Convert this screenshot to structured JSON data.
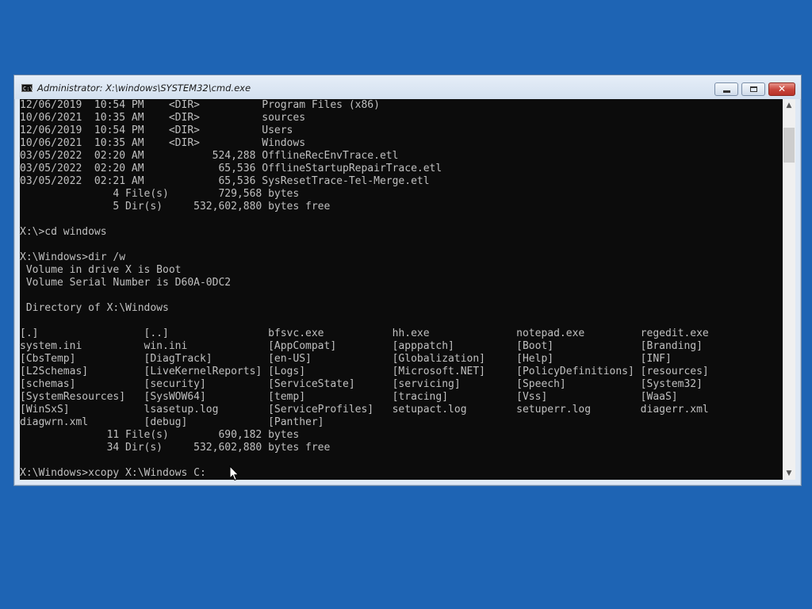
{
  "window": {
    "title": "Administrator: X:\\windows\\SYSTEM32\\cmd.exe",
    "app_icon_text": "C:\\"
  },
  "titlebar_controls": {
    "minimize": "minimize-icon",
    "maximize": "maximize-icon",
    "close": "close-icon"
  },
  "console": {
    "lines": [
      "12/06/2019  10:54 PM    <DIR>          Program Files (x86)",
      "10/06/2021  10:35 AM    <DIR>          sources",
      "12/06/2019  10:54 PM    <DIR>          Users",
      "10/06/2021  10:35 AM    <DIR>          Windows",
      "03/05/2022  02:20 AM           524,288 OfflineRecEnvTrace.etl",
      "03/05/2022  02:20 AM            65,536 OfflineStartupRepairTrace.etl",
      "03/05/2022  02:21 AM            65,536 SysResetTrace-Tel-Merge.etl",
      "               4 File(s)        729,568 bytes",
      "               5 Dir(s)     532,602,880 bytes free",
      "",
      "X:\\>cd windows",
      "",
      "X:\\Windows>dir /w",
      " Volume in drive X is Boot",
      " Volume Serial Number is D60A-0DC2",
      "",
      " Directory of X:\\Windows",
      "",
      "[.]                 [..]                bfsvc.exe           hh.exe              notepad.exe         regedit.exe",
      "system.ini          win.ini             [AppCompat]         [apppatch]          [Boot]              [Branding]",
      "[CbsTemp]           [DiagTrack]         [en-US]             [Globalization]     [Help]              [INF]",
      "[L2Schemas]         [LiveKernelReports] [Logs]              [Microsoft.NET]     [PolicyDefinitions] [resources]",
      "[schemas]           [security]          [ServiceState]      [servicing]         [Speech]            [System32]",
      "[SystemResources]   [SysWOW64]          [temp]              [tracing]           [Vss]               [WaaS]",
      "[WinSxS]            lsasetup.log        [ServiceProfiles]   setupact.log        setuperr.log        diagerr.xml",
      "diagwrn.xml         [debug]             [Panther]",
      "              11 File(s)        690,182 bytes",
      "              34 Dir(s)     532,602,880 bytes free",
      "",
      "X:\\Windows>xcopy X:\\Windows C:"
    ]
  },
  "scrollbar": {
    "up": "▲",
    "down": "▼"
  },
  "colors": {
    "desktop": "#1e64b4",
    "console_bg": "#0c0c0c",
    "console_fg": "#c0c0c0",
    "close_button": "#c7443a"
  }
}
